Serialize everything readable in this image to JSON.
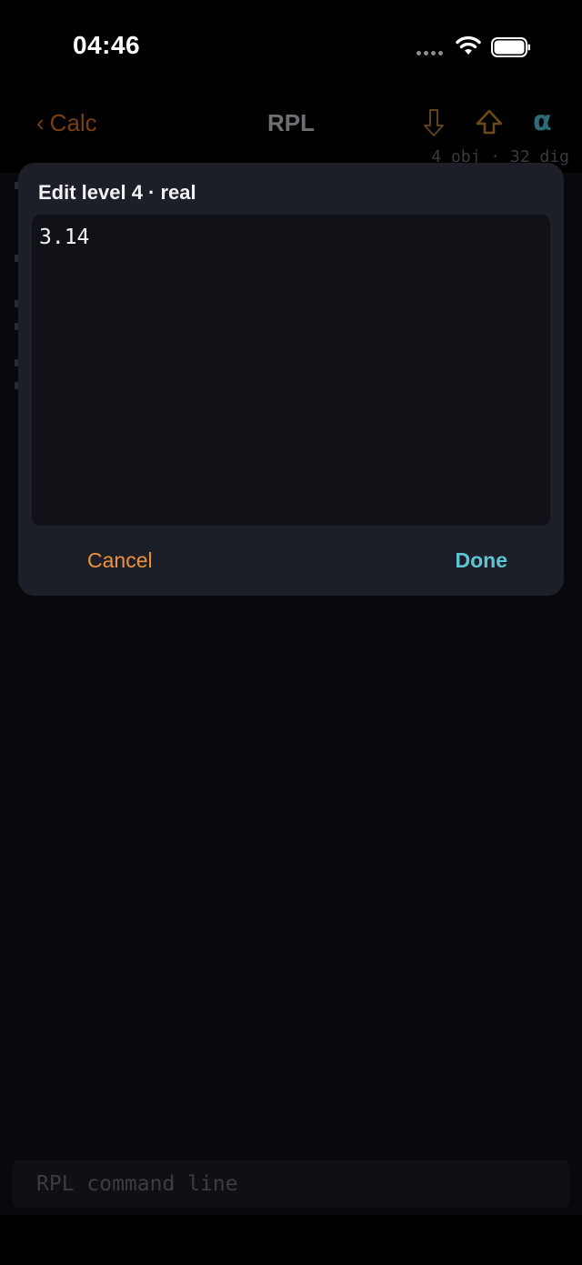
{
  "status_bar": {
    "time": "04:46"
  },
  "nav": {
    "back_label": "Calc",
    "back_chevron": "‹",
    "title": "RPL",
    "alpha_label": "α",
    "stack_info": "4 obj · 32 dig"
  },
  "modal": {
    "title": "Edit level 4 · real",
    "editor_value": "3.14",
    "cancel_label": "Cancel",
    "done_label": "Done"
  },
  "command_line": {
    "placeholder": "RPL command line",
    "value": ""
  },
  "colors": {
    "accent_orange": "#f0913a",
    "accent_teal": "#5fc4d4",
    "modal_bg": "#1c1f28",
    "editor_bg": "#111217"
  },
  "icons": {
    "drop": "arrow-down-outline-icon",
    "shift": "shift-arrow-up-icon",
    "wifi": "wifi-icon",
    "battery": "battery-full-icon",
    "signal": "cellular-dots-icon"
  }
}
